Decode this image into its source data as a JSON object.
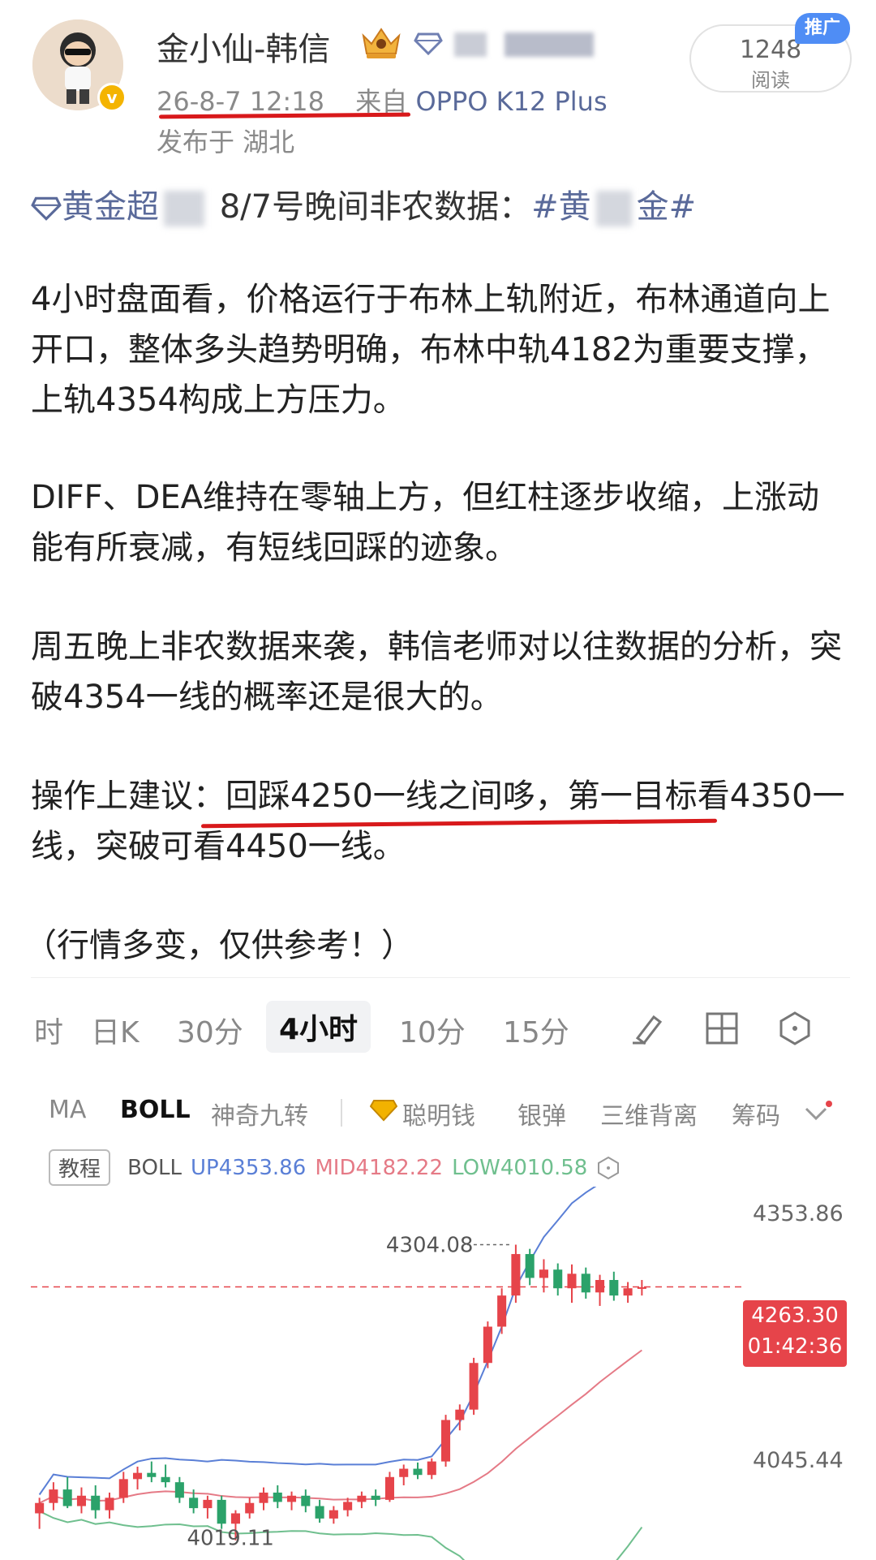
{
  "post": {
    "username": "金小仙-韩信",
    "timestamp": "26-8-7 12:18",
    "source_prefix": "来自",
    "device": "OPPO K12 Plus",
    "location": "发布于 湖北",
    "read_count": "1248",
    "read_label": "阅读",
    "promo_tag": "推广",
    "topic_link": "黄金超",
    "topic_text": "8/7号晚间非农数据：",
    "hashtag_open": "#黄",
    "hashtag_close": "金#",
    "paragraphs": [
      "4小时盘面看，价格运行于布林上轨附近，布林通道向上开口，整体多头趋势明确，布林中轨4182为重要支撑，上轨4354构成上方压力。",
      "DIFF、DEA维持在零轴上方，但红柱逐步收缩，上涨动能有所衰减，有短线回踩的迹象。",
      "周五晚上非农数据来袭，韩信老师对以往数据的分析，突破4354一线的概率还是很大的。",
      "操作上建议：回踩4250一线之间哆，第一目标看4350一线，突破可看4450一线。",
      "（行情多变，仅供参考！）"
    ]
  },
  "chart": {
    "timeframe_tabs": [
      "时",
      "日K",
      "30分",
      "4小时",
      "10分",
      "15分"
    ],
    "active_tab": "4小时",
    "tool_icons": [
      "draw-tool-icon",
      "grid-icon",
      "settings-hexagon-icon"
    ],
    "indicators": [
      "MA",
      "BOLL",
      "神奇九转",
      "聪明钱",
      "银弹",
      "三维背离",
      "筹码"
    ],
    "active_indicator": "BOLL",
    "tutorial_label": "教程",
    "legend_name": "BOLL",
    "legend_up": "UP4353.86",
    "legend_mid": "MID4182.22",
    "legend_low": "LOW4010.58",
    "axis_top": "4353.86",
    "axis_bottom": "4045.44",
    "high_label": "4304.08",
    "low_label": "4019.11",
    "current_price": "4263.30",
    "countdown": "01:42:36",
    "colors": {
      "up": "#e6444a",
      "down": "#2ba26a",
      "boll_up": "#5a7fd6",
      "boll_mid": "#e57a86",
      "boll_low": "#6fbf8e"
    }
  },
  "chart_data": {
    "type": "candlestick",
    "title": "",
    "indicator": "BOLL",
    "boll": {
      "up": 4353.86,
      "mid": 4182.22,
      "low": 4010.58
    },
    "last_price": 4263.3,
    "visible_high": 4304.08,
    "visible_low": 4019.11,
    "ylim": [
      4000,
      4360
    ],
    "candles": [
      [
        4045,
        4060,
        4030,
        4055
      ],
      [
        4055,
        4075,
        4048,
        4068
      ],
      [
        4068,
        4080,
        4050,
        4052
      ],
      [
        4052,
        4070,
        4045,
        4062
      ],
      [
        4062,
        4072,
        4040,
        4048
      ],
      [
        4048,
        4065,
        4040,
        4060
      ],
      [
        4060,
        4085,
        4055,
        4078
      ],
      [
        4078,
        4090,
        4068,
        4084
      ],
      [
        4084,
        4095,
        4075,
        4080
      ],
      [
        4080,
        4092,
        4070,
        4075
      ],
      [
        4075,
        4080,
        4055,
        4060
      ],
      [
        4060,
        4068,
        4045,
        4050
      ],
      [
        4050,
        4062,
        4040,
        4058
      ],
      [
        4058,
        4062,
        4030,
        4035
      ],
      [
        4035,
        4048,
        4019,
        4045
      ],
      [
        4045,
        4060,
        4040,
        4055
      ],
      [
        4055,
        4070,
        4048,
        4065
      ],
      [
        4065,
        4072,
        4050,
        4056
      ],
      [
        4056,
        4066,
        4048,
        4062
      ],
      [
        4062,
        4068,
        4046,
        4052
      ],
      [
        4052,
        4058,
        4036,
        4040
      ],
      [
        4040,
        4052,
        4035,
        4048
      ],
      [
        4048,
        4060,
        4042,
        4056
      ],
      [
        4056,
        4066,
        4050,
        4062
      ],
      [
        4062,
        4068,
        4052,
        4058
      ],
      [
        4058,
        4085,
        4056,
        4080
      ],
      [
        4080,
        4092,
        4072,
        4088
      ],
      [
        4088,
        4094,
        4078,
        4082
      ],
      [
        4082,
        4098,
        4078,
        4095
      ],
      [
        4095,
        4140,
        4090,
        4135
      ],
      [
        4135,
        4150,
        4125,
        4145
      ],
      [
        4145,
        4195,
        4140,
        4190
      ],
      [
        4190,
        4230,
        4185,
        4225
      ],
      [
        4225,
        4262,
        4218,
        4255
      ],
      [
        4255,
        4304,
        4248,
        4295
      ],
      [
        4295,
        4300,
        4265,
        4272
      ],
      [
        4272,
        4290,
        4258,
        4280
      ],
      [
        4280,
        4286,
        4255,
        4262
      ],
      [
        4262,
        4285,
        4248,
        4276
      ],
      [
        4276,
        4282,
        4252,
        4258
      ],
      [
        4258,
        4275,
        4245,
        4270
      ],
      [
        4270,
        4278,
        4250,
        4255
      ],
      [
        4255,
        4268,
        4248,
        4262
      ],
      [
        4262,
        4270,
        4255,
        4263
      ]
    ]
  }
}
